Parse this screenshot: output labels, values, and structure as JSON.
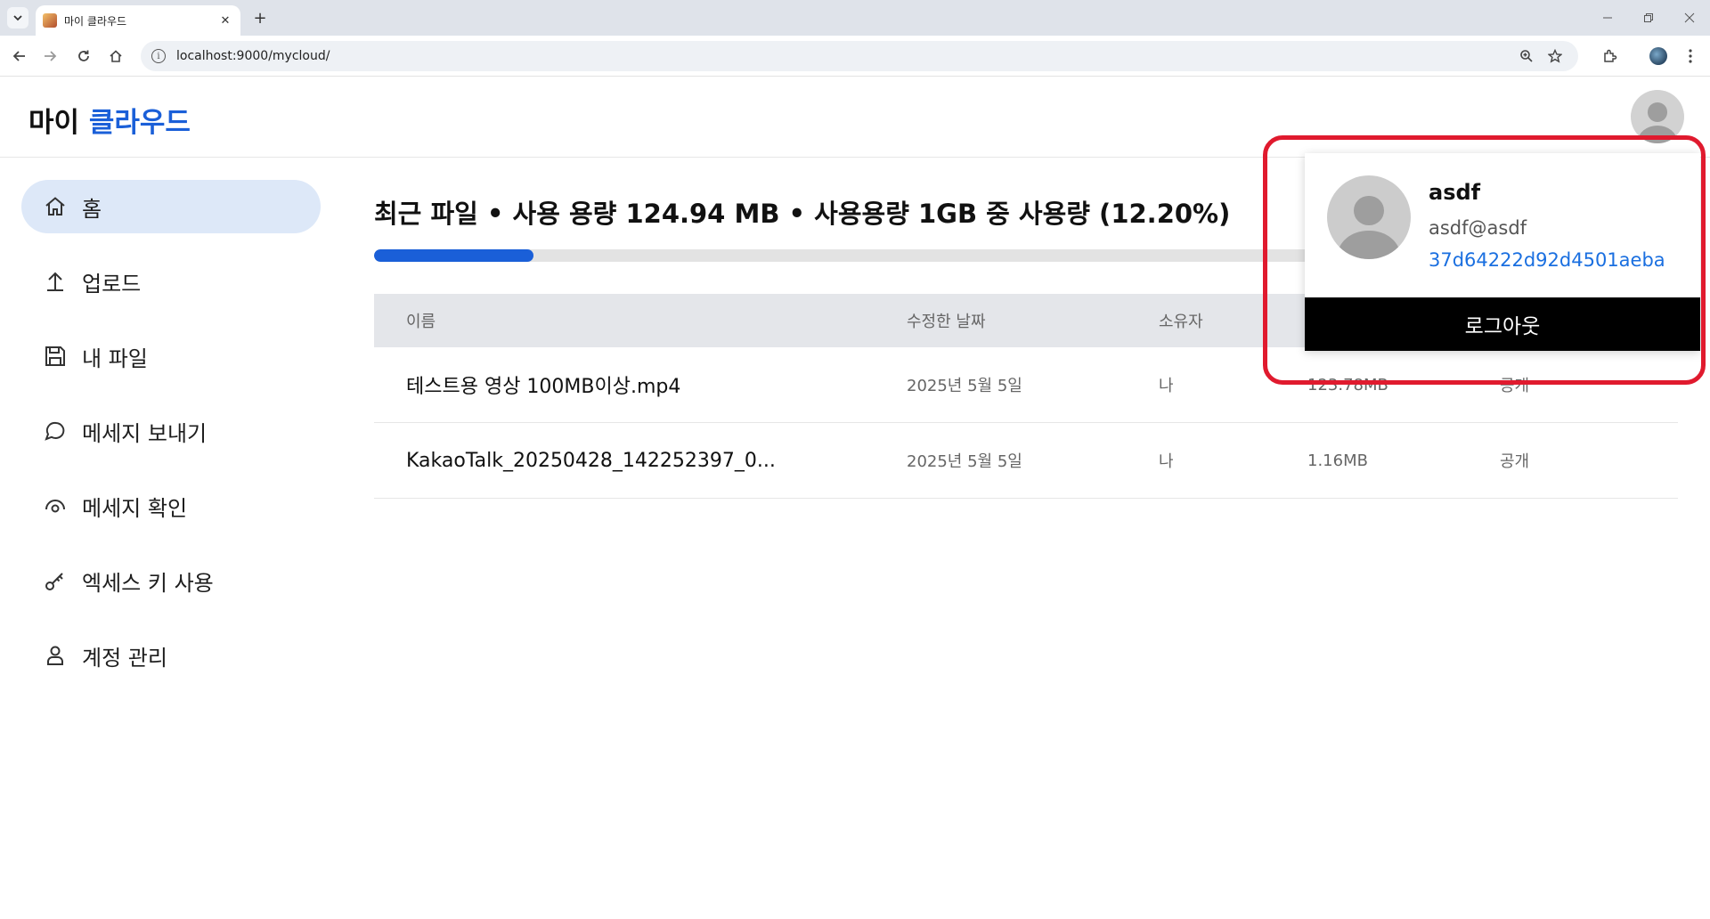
{
  "browser": {
    "tab_title": "마이 클라우드",
    "tab_close": "✕",
    "new_tab": "+",
    "url": "localhost:9000/mycloud/"
  },
  "brand": {
    "part1": "마이",
    "part2": "클라우드"
  },
  "sidebar": {
    "items": [
      {
        "label": "홈",
        "icon": "home-icon"
      },
      {
        "label": "업로드",
        "icon": "upload-icon"
      },
      {
        "label": "내 파일",
        "icon": "save-icon"
      },
      {
        "label": "메세지 보내기",
        "icon": "chat-icon"
      },
      {
        "label": "메세지 확인",
        "icon": "eye-icon"
      },
      {
        "label": "엑세스 키 사용",
        "icon": "key-icon"
      },
      {
        "label": "계정 관리",
        "icon": "person-icon"
      }
    ]
  },
  "main": {
    "title": "최근 파일 • 사용 용량 124.94 MB • 사용용량 1GB 중 사용량 (12.20%)",
    "usage_fraction": 0.122
  },
  "table": {
    "headers": {
      "name": "이름",
      "modified": "수정한 날짜",
      "owner": "소유자"
    },
    "rows": [
      {
        "name": "테스트용 영상 100MB이상.mp4",
        "modified": "2025년 5월 5일",
        "owner": "나",
        "size": "123.78MB",
        "sharing": "공개"
      },
      {
        "name": "KakaoTalk_20250428_142252397_0...",
        "modified": "2025년 5월 5일",
        "owner": "나",
        "size": "1.16MB",
        "sharing": "공개"
      }
    ]
  },
  "profile": {
    "name": "asdf",
    "email": "asdf@asdf",
    "key": "37d64222d92d4501aeba",
    "logout_label": "로그아웃"
  },
  "colors": {
    "accent": "#1a5fd8",
    "active_nav_bg": "#dde8f8",
    "annotation": "#e01a2e"
  }
}
